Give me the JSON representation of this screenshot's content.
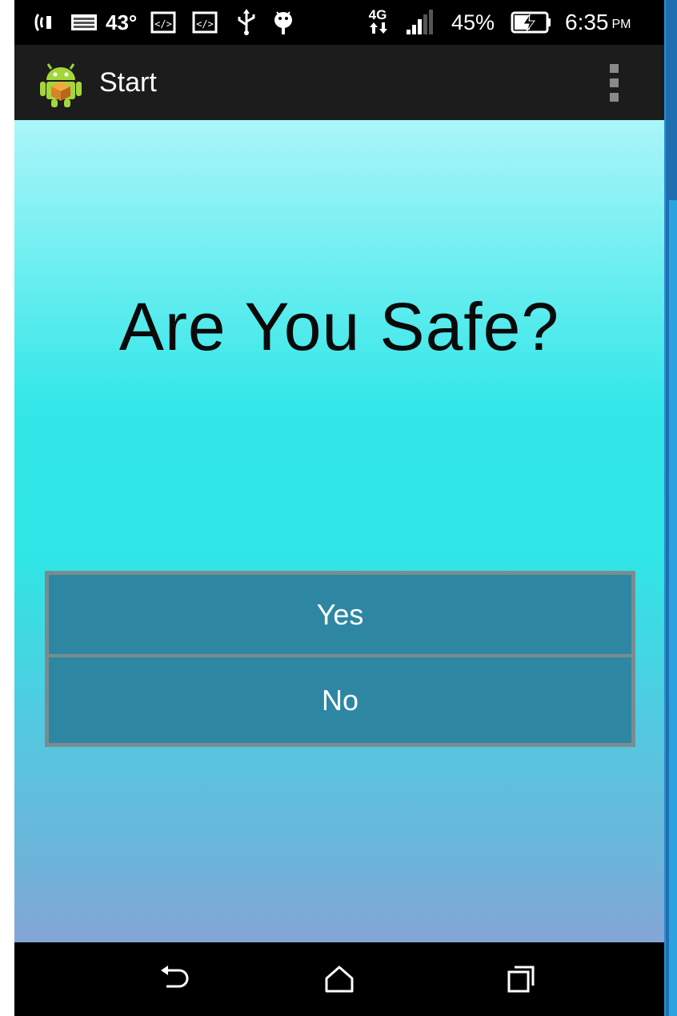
{
  "status_bar": {
    "icons": [
      "wifi-calling-icon",
      "keyboard-icon",
      "code-notification-icon",
      "code-notification-icon",
      "usb-icon",
      "android-debug-icon",
      "lte-icon",
      "signal-icon",
      "battery-charging-icon"
    ],
    "temperature": "43°",
    "network": "4G",
    "battery": "45%",
    "time": "6:35",
    "ampm": "PM"
  },
  "action_bar": {
    "title": "Start",
    "app_icon": "android-app-icon",
    "overflow_icon": "overflow-menu-icon"
  },
  "main": {
    "question": "Are You Safe?",
    "buttons": {
      "yes": "Yes",
      "no": "No"
    }
  },
  "nav_bar": {
    "icons": [
      "back-icon",
      "home-icon",
      "recents-icon"
    ]
  },
  "colors": {
    "button_bg": "#2d87a3",
    "button_border": "#7a8c8f",
    "action_bar": "#1c1c1c",
    "gradient_top": "#aaf6fa",
    "gradient_mid": "#2ee7e6",
    "gradient_bottom": "#85a5d6"
  }
}
